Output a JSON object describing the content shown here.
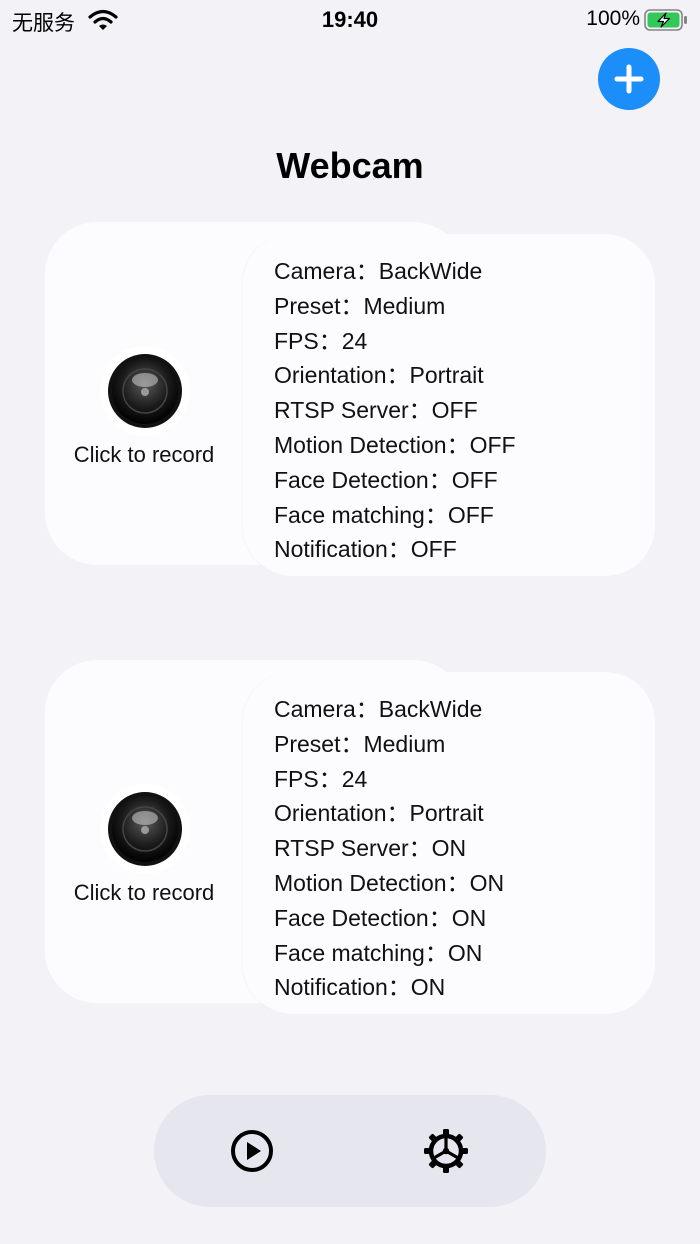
{
  "status_bar": {
    "carrier": "无服务",
    "time": "19:40",
    "battery_percent": "100%",
    "wifi_icon": "wifi-icon",
    "battery_icon": "battery-charging-icon"
  },
  "header": {
    "add_icon": "plus-icon",
    "title": "Webcam"
  },
  "cameras": [
    {
      "record_label": "Click to record",
      "settings": [
        "Camera：BackWide",
        "Preset：Medium",
        "FPS：24",
        "Orientation：Portrait",
        "RTSP Server：OFF",
        "Motion Detection：OFF",
        "Face Detection：OFF",
        "Face matching：OFF",
        "Notification：OFF"
      ]
    },
    {
      "record_label": "Click to record",
      "settings": [
        "Camera：BackWide",
        "Preset：Medium",
        "FPS：24",
        "Orientation：Portrait",
        "RTSP Server：ON",
        "Motion Detection：ON",
        "Face Detection：ON",
        "Face matching：ON",
        "Notification：ON"
      ]
    }
  ],
  "tab_bar": {
    "play_icon": "play-circle-icon",
    "settings_icon": "gear-icon"
  },
  "colors": {
    "accent": "#1c8ef9",
    "background": "#f2f2f7",
    "card": "#fcfcfe",
    "battery": "#34c759"
  }
}
